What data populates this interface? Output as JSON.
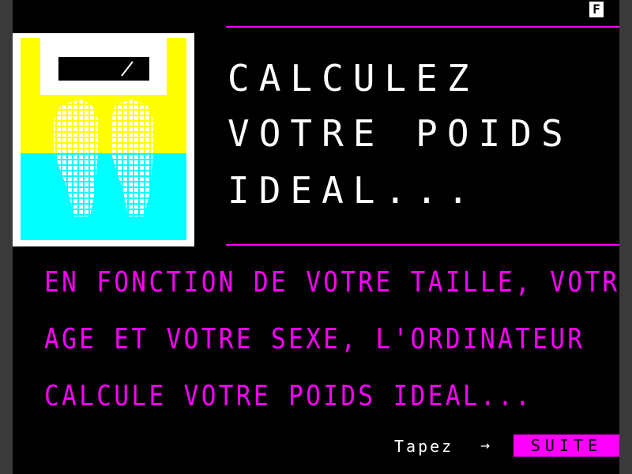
{
  "header": {
    "indicator": "F"
  },
  "illustration": {
    "icon": "bathroom-scale-feet-icon"
  },
  "title": {
    "lines": [
      "CALCULEZ",
      "VOTRE POIDS",
      "IDEAL..."
    ]
  },
  "body": {
    "lines": [
      "EN FONCTION DE VOTRE TAILLE, VOTRE",
      "AGE ET VOTRE SEXE, L'ORDINATEUR",
      "CALCULE VOTRE POIDS IDEAL..."
    ]
  },
  "footer": {
    "prompt": "Tapez",
    "arrow": "→",
    "suite_label": "SUITE"
  },
  "colors": {
    "background": "#000000",
    "accent": "#ff00ff",
    "illustration_top": "#ffff00",
    "illustration_bottom": "#00ffff",
    "text": "#ffffff"
  }
}
